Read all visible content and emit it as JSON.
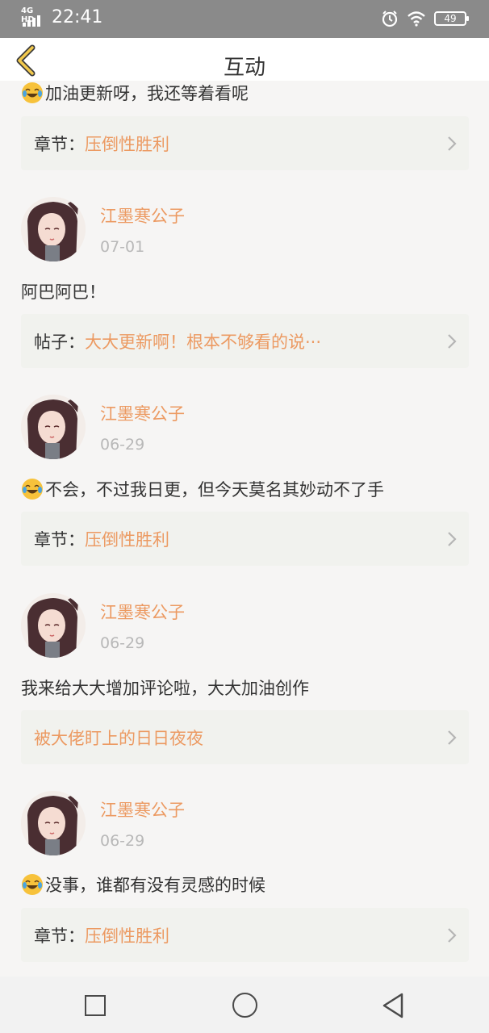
{
  "status_bar": {
    "network": "4G HD",
    "time": "22:41",
    "battery": "49"
  },
  "header": {
    "title": "互动"
  },
  "top_partial": {
    "comment": "加油更新呀，我还等着看呢",
    "ref_prefix": "章节：",
    "ref_title": "压倒性胜利"
  },
  "items": [
    {
      "user": "江墨寒公子",
      "date": "07-01",
      "comment": "阿巴阿巴！",
      "ref_prefix": "帖子：",
      "ref_title": "大大更新啊！根本不够看的说···"
    },
    {
      "user": "江墨寒公子",
      "date": "06-29",
      "comment": "不会，不过我日更，但今天莫名其妙动不了手",
      "ref_prefix": "章节：",
      "ref_title": "压倒性胜利"
    },
    {
      "user": "江墨寒公子",
      "date": "06-29",
      "comment": "我来给大大增加评论啦，大大加油创作",
      "ref_prefix": "",
      "ref_title": "被大佬盯上的日日夜夜"
    },
    {
      "user": "江墨寒公子",
      "date": "06-29",
      "comment": "没事，谁都有没有灵感的时候",
      "ref_prefix": "章节：",
      "ref_title": "压倒性胜利"
    }
  ],
  "icons": {
    "back": "back-arrow-icon",
    "emoji": "laughing-tears-emoji-icon",
    "chevron": "chevron-right-icon"
  },
  "colors": {
    "accent": "#ec9a62",
    "back_arrow": "#f2c94c"
  }
}
